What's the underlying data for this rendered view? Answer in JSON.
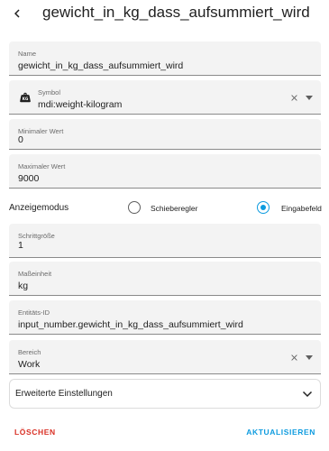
{
  "header": {
    "title": "gewicht_in_kg_dass_aufsummiert_wird"
  },
  "name_field": {
    "label": "Name",
    "value": "gewicht_in_kg_dass_aufsummiert_wird"
  },
  "symbol_field": {
    "label": "Symbol",
    "value": "mdi:weight-kilogram",
    "icon": "weight-kilogram-icon"
  },
  "min_field": {
    "label": "Minimaler Wert",
    "value": "0"
  },
  "max_field": {
    "label": "Maximaler Wert",
    "value": "9000"
  },
  "display_mode": {
    "label": "Anzeigemodus",
    "options": [
      {
        "label": "Schieberegler",
        "checked": false
      },
      {
        "label": "Eingabefeld",
        "checked": true
      }
    ]
  },
  "step_field": {
    "label": "Schrittgröße",
    "value": "1"
  },
  "unit_field": {
    "label": "Maßeinheit",
    "value": "kg"
  },
  "entity_field": {
    "label": "Entitäts-ID",
    "value": "input_number.gewicht_in_kg_dass_aufsummiert_wird"
  },
  "area_field": {
    "label": "Bereich",
    "value": "Work"
  },
  "advanced": {
    "label": "Erweiterte Einstellungen"
  },
  "actions": {
    "delete_label": "LÖSCHEN",
    "update_label": "AKTUALISIEREN"
  },
  "colors": {
    "accent": "#0d9bdf",
    "danger": "#d93025",
    "field_bg": "#f3f3f3"
  }
}
